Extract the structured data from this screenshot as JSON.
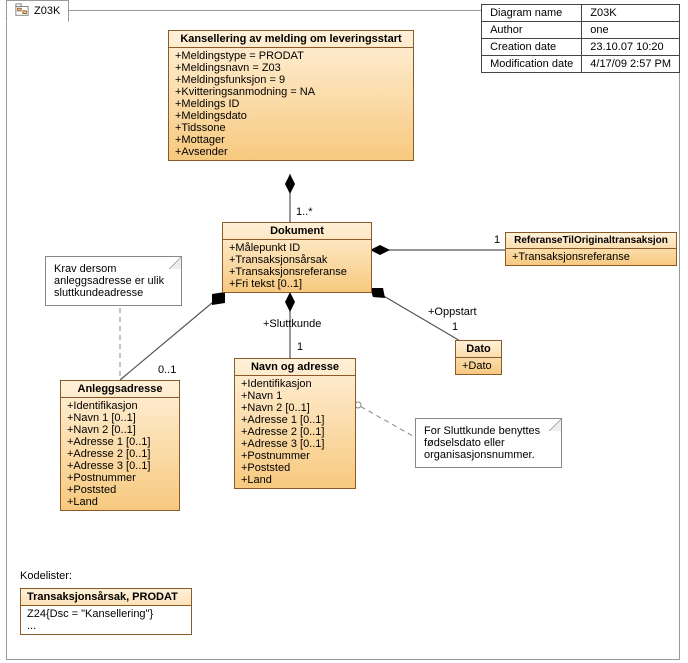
{
  "tab_label": "Z03K",
  "meta": {
    "h_name": "Diagram name",
    "v_name": "Z03K",
    "h_author": "Author",
    "v_author": "one",
    "h_created": "Creation date",
    "v_created": "23.10.07 10:20",
    "h_modified": "Modification date",
    "v_modified": "4/17/09 2:57 PM"
  },
  "classes": {
    "kans": {
      "title": "Kansellering av melding om leveringsstart",
      "attrs": [
        "+Meldingstype = PRODAT",
        "+Meldingsnavn = Z03",
        "+Meldingsfunksjon = 9",
        "+Kvitteringsanmodning = NA",
        "+Meldings ID",
        "+Meldingsdato",
        "+Tidssone",
        "+Mottager",
        "+Avsender"
      ]
    },
    "dokument": {
      "title": "Dokument",
      "attrs": [
        "+Målepunkt ID",
        "+Transaksjonsårsak",
        "+Transaksjonsreferanse",
        "+Fri tekst [0..1]"
      ]
    },
    "ref": {
      "title": "ReferanseTilOriginaltransaksjon",
      "attrs": [
        "+Transaksjonsreferanse"
      ]
    },
    "anlegg": {
      "title": "Anleggsadresse",
      "attrs": [
        "+Identifikasjon",
        "+Navn 1 [0..1]",
        "+Navn 2 [0..1]",
        "+Adresse 1 [0..1]",
        "+Adresse 2 [0..1]",
        "+Adresse 3 [0..1]",
        "+Postnummer",
        "+Poststed",
        "+Land"
      ]
    },
    "navn": {
      "title": "Navn og adresse",
      "attrs": [
        "+Identifikasjon",
        "+Navn 1",
        "+Navn 2 [0..1]",
        "+Adresse 1 [0..1]",
        "+Adresse 2 [0..1]",
        "+Adresse 3 [0..1]",
        "+Postnummer",
        "+Poststed",
        "+Land"
      ]
    },
    "dato": {
      "title": "Dato",
      "attrs": [
        "+Dato"
      ]
    }
  },
  "notes": {
    "krav": [
      "Krav dersom",
      "anleggsadresse er ulik",
      "sluttkundeadresse"
    ],
    "slutt": [
      "For Sluttkunde benyttes",
      "fødselsdato eller",
      "organisasjonsnummer."
    ]
  },
  "labels": {
    "m_kans_dok": "1..*",
    "m_ref": "1",
    "m_anlegg": "0..1",
    "r_slutt": "+Sluttkunde",
    "m_slutt": "1",
    "r_oppstart": "+Oppstart",
    "m_oppstart": "1"
  },
  "kodelist_label": "Kodelister:",
  "kodelist": {
    "title": "Transaksjonsårsak, PRODAT",
    "rows": [
      "Z24{Dsc = \"Kansellering\"}",
      "..."
    ]
  }
}
